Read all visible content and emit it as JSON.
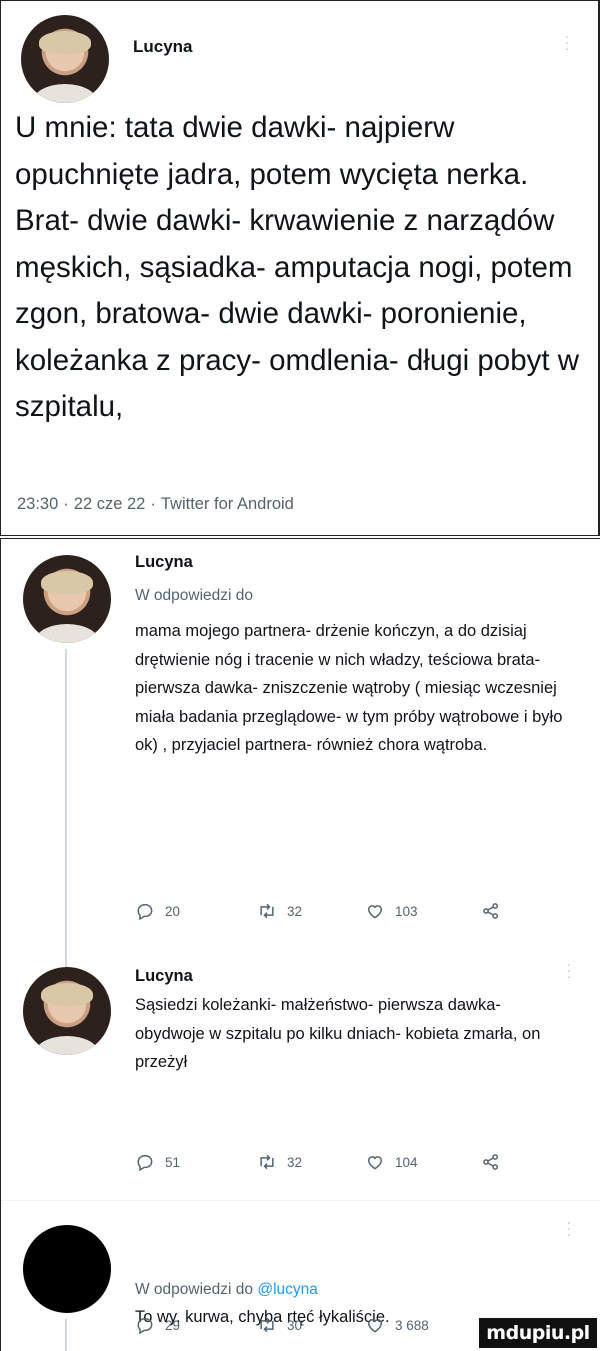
{
  "main_tweet": {
    "author": "Lucyna",
    "text": "U mnie: tata dwie dawki- najpierw opuchnięte jadra, potem wycięta nerka. Brat- dwie dawki- krwawienie z narządów męskich, sąsiadka- amputacja nogi, potem zgon, bratowa- dwie dawki- poronienie, koleżanka z pracy- omdlenia- długi pobyt w szpitalu,",
    "time": "23:30",
    "date": "22 cze 22",
    "client": "Twitter for Android"
  },
  "replies": [
    {
      "author": "Lucyna",
      "reply_to": "W odpowiedzi do",
      "text": "mama mojego partnera- drżenie kończyn, a do dzisiaj drętwienie nóg i tracenie w nich władzy, teściowa brata- pierwsza dawka- zniszczenie wątroby ( miesiąc wczesniej miała badania przeglądowe- w tym próby wątrobowe i było ok) , przyjaciel partnera- również chora wątroba.",
      "replies": "20",
      "retweets": "32",
      "likes": "103"
    },
    {
      "author": "Lucyna",
      "text": "Sąsiedzi koleżanki- małżeństwo- pierwsza dawka- obydwoje w szpitalu po kilku dniach- kobieta zmarła, on przeżył",
      "replies": "51",
      "retweets": "32",
      "likes": "104"
    },
    {
      "reply_prefix": "W odpowiedzi do",
      "mention": "@lucyna",
      "text": "To wy, kurwa, chyba rtęć łykaliście.",
      "replies": "29",
      "retweets": "30",
      "likes": "3 688"
    }
  ],
  "watermark": "mdupiu.pl",
  "icons": {
    "reply": "reply-icon",
    "retweet": "retweet-icon",
    "like": "heart-icon",
    "share": "share-icon",
    "more": "more-icon"
  },
  "colors": {
    "text": "#0f1419",
    "secondary": "#536471",
    "link": "#1d9bf0",
    "thread_line": "#cfd9de"
  }
}
